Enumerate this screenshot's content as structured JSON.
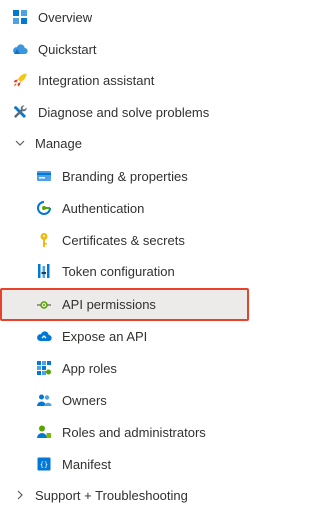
{
  "menu": {
    "items": [
      {
        "label": "Overview",
        "icon": "grid-icon"
      },
      {
        "label": "Quickstart",
        "icon": "cloud-icon"
      },
      {
        "label": "Integration assistant",
        "icon": "rocket-icon"
      },
      {
        "label": "Diagnose and solve problems",
        "icon": "wrench-icon"
      }
    ],
    "manage": {
      "label": "Manage",
      "expanded": true,
      "items": [
        {
          "label": "Branding & properties",
          "icon": "card-icon"
        },
        {
          "label": "Authentication",
          "icon": "auth-icon"
        },
        {
          "label": "Certificates & secrets",
          "icon": "key-icon"
        },
        {
          "label": "Token configuration",
          "icon": "bars-icon"
        },
        {
          "label": "API permissions",
          "icon": "api-icon",
          "selected": true
        },
        {
          "label": "Expose an API",
          "icon": "cloud-api-icon"
        },
        {
          "label": "App roles",
          "icon": "app-grid-icon"
        },
        {
          "label": "Owners",
          "icon": "people-icon"
        },
        {
          "label": "Roles and administrators",
          "icon": "user-admin-icon"
        },
        {
          "label": "Manifest",
          "icon": "manifest-icon"
        }
      ]
    },
    "support": {
      "label": "Support + Troubleshooting",
      "expanded": false
    }
  },
  "colors": {
    "selected_border": "#e8432a",
    "selected_bg": "#edebe9",
    "text": "#323130",
    "azure_blue": "#0078d4"
  }
}
